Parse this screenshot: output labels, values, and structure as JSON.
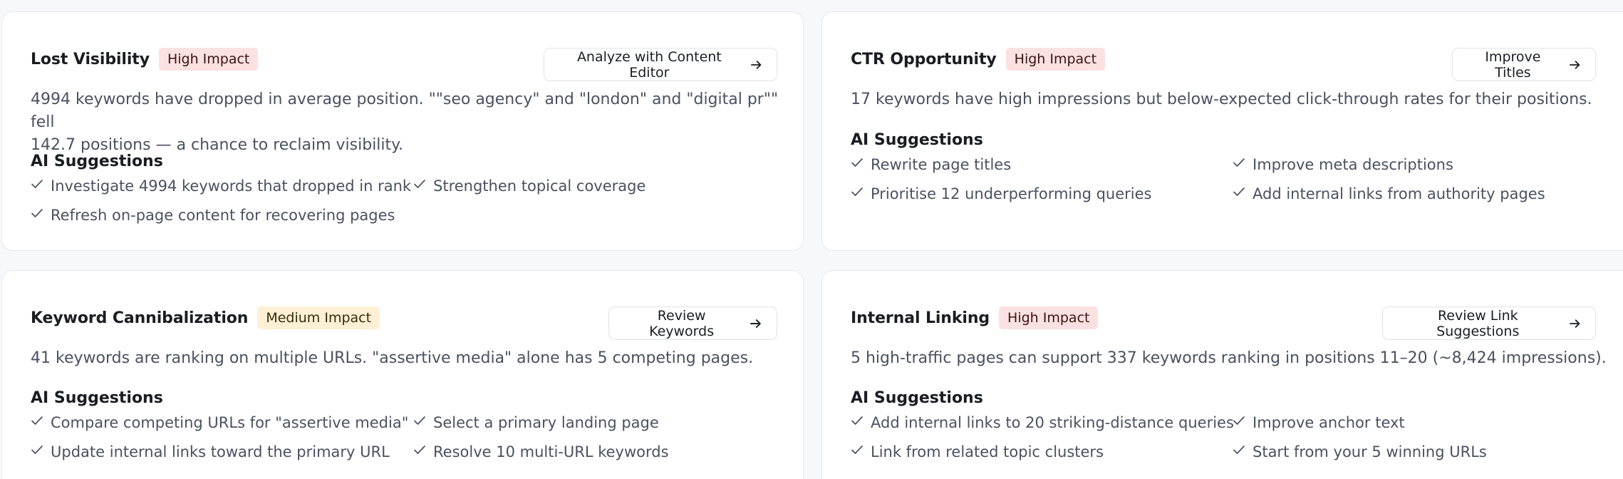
{
  "cards": [
    {
      "title": "Lost Visibility",
      "impact": "High Impact",
      "action": "Analyze with Content Editor",
      "description_line1": "4994 keywords have dropped in average position. \"\"seo agency\" and \"london\" and \"digital pr\"\" fell",
      "description_line2": "142.7 positions — a chance to reclaim visibility.",
      "ai_title": "AI Suggestions",
      "suggestions": [
        "Investigate 4994 keywords that dropped in rank",
        "Strengthen topical coverage",
        "Refresh on-page content for recovering pages"
      ]
    },
    {
      "title": "CTR Opportunity",
      "impact": "High Impact",
      "action": "Improve Titles",
      "description_line1": "17 keywords have high impressions but below-expected click-through rates for their positions.",
      "ai_title": "AI Suggestions",
      "suggestions": [
        "Rewrite page titles",
        "Improve meta descriptions",
        "Prioritise 12 underperforming queries",
        "Add internal links from authority pages"
      ]
    },
    {
      "title": "Keyword Cannibalization",
      "impact": "Medium Impact",
      "action": "Review Keywords",
      "description_line1": "41 keywords are ranking on multiple URLs. \"assertive media\" alone has 5 competing pages.",
      "ai_title": "AI Suggestions",
      "suggestions": [
        "Compare competing URLs for \"assertive media\"",
        "Select a primary landing page",
        "Update internal links toward the primary URL",
        "Resolve 10 multi-URL keywords"
      ]
    },
    {
      "title": "Internal Linking",
      "impact": "High Impact",
      "action": "Review Link Suggestions",
      "description_line1": "5 high-traffic pages can support 337 keywords ranking in positions 11–20 (~8,424 impressions).",
      "ai_title": "AI Suggestions",
      "suggestions": [
        "Add internal links to 20 striking-distance queries",
        "Improve anchor text",
        "Link from related topic clusters",
        "Start from your 5 winning URLs"
      ]
    }
  ],
  "icons": {
    "action": "arrow-right-icon",
    "suggestion": "check-icon"
  },
  "colors": {
    "high_badge_bg": "#fbe1e1",
    "medium_badge_bg": "#fdf0d5",
    "body_text": "#4a5160"
  }
}
